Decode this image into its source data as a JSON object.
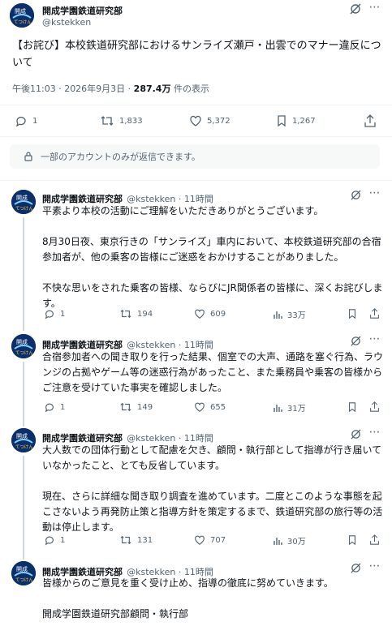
{
  "main": {
    "name": "開成学園鉄道研究部",
    "handle": "@kstekken",
    "text": "【お詫び】本校鉄道研究部におけるサンライズ瀬戸・出雲でのマナー違反について",
    "timestamp": "午後11:03 · 2026年9月3日 · ",
    "views_count": "287.4万",
    "views_label": " 件の表示",
    "stats": {
      "replies": "1",
      "reposts": "1,833",
      "likes": "5,372",
      "bookmarks": "1,267"
    }
  },
  "reply_restriction": "一部のアカウントのみが返信できます。",
  "replies": [
    {
      "name": "開成学園鉄道研究部",
      "handle_time": "@kstekken · 11時間",
      "text": "平素より本校の活動にご理解をいただきありがとうございます。\n\n8月30日夜、東京行きの「サンライズ」車内において、本校鉄道研究部の合宿参加者が、他の乗客の皆様にご迷惑をおかけすることがありました。\n\n不快な思いをされた乗客の皆様、ならびにJR関係者の皆様に、深くお詫びします。",
      "replies": "1",
      "reposts": "194",
      "likes": "609",
      "views": "33万"
    },
    {
      "name": "開成学園鉄道研究部",
      "handle_time": "@kstekken · 11時間",
      "text": "合宿参加者への聞き取りを行った結果、個室での大声、通路を塞ぐ行為、ラウンジの占拠やゲーム等の迷惑行為があったこと、また乗務員や乗客の皆様からご注意を受けていた事実を確認しました。",
      "replies": "1",
      "reposts": "149",
      "likes": "655",
      "views": "31万"
    },
    {
      "name": "開成学園鉄道研究部",
      "handle_time": "@kstekken · 11時間",
      "text": "大人数での団体行動として配慮を欠き、顧問・執行部として指導が行き届いていなかったこと、とても反省しています。\n\n現在、さらに詳細な聞き取り調査を進めています。二度とこのような事態を起こさないよう再発防止策と指導方針を策定するまで、鉄道研究部の旅行等の活動は停止します。",
      "replies": "1",
      "reposts": "131",
      "likes": "707",
      "views": "30万"
    },
    {
      "name": "開成学園鉄道研究部",
      "handle_time": "@kstekken · 11時間",
      "text": "皆様からのご意見を重く受け止め、指導の徹底に努めていきます。\n\n開成学園鉄道研究部顧問・執行部"
    }
  ],
  "avatar_text": "開成 てつけん",
  "colors": {
    "accent": "#1d9bf0",
    "secondary_text": "#536471",
    "avatar_bg": "#0b2f6b"
  }
}
